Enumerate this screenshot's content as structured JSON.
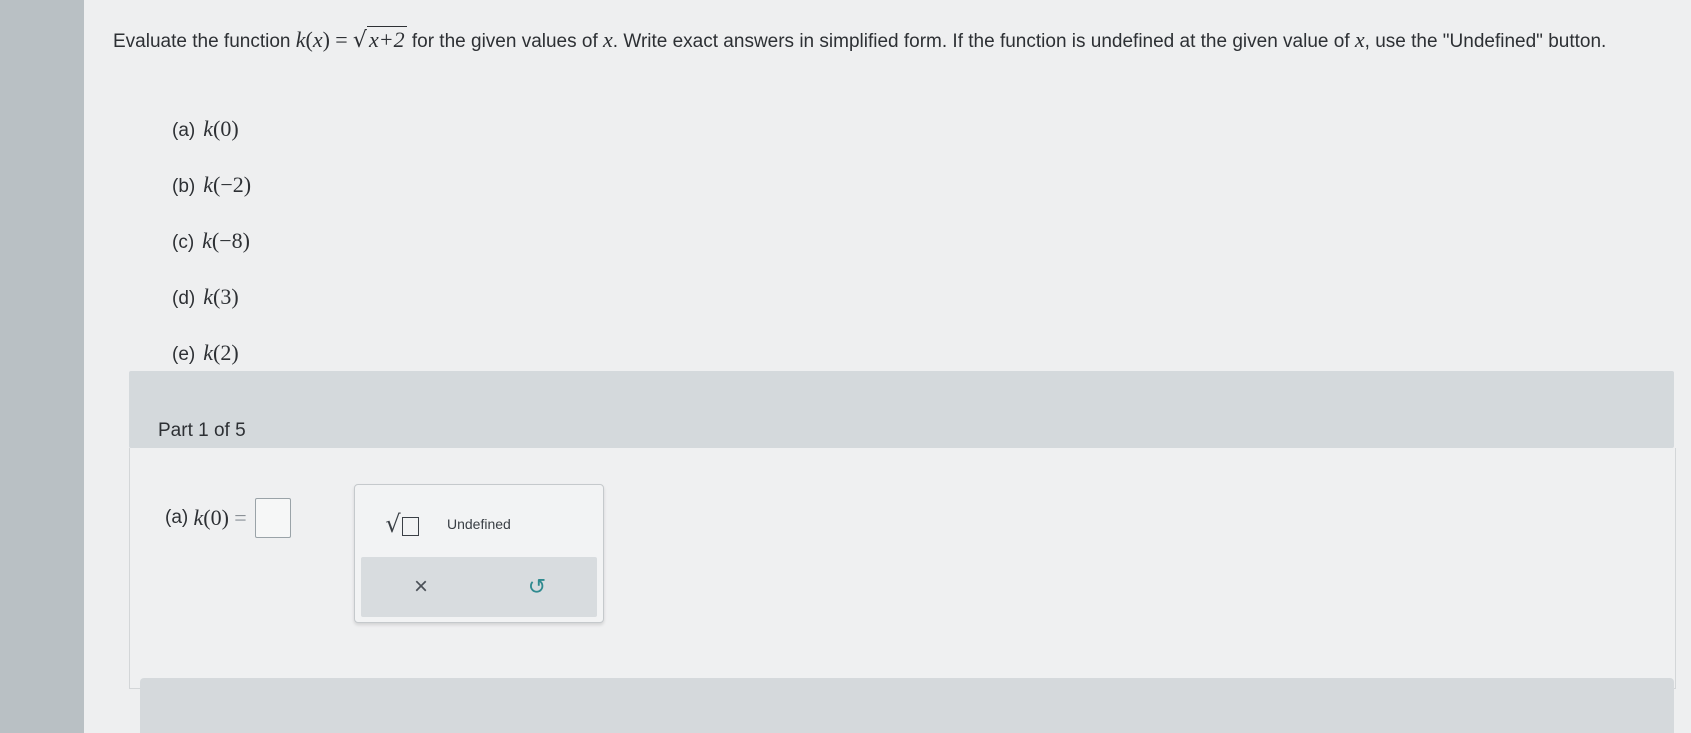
{
  "prompt": {
    "text_before": "Evaluate the function ",
    "func_name": "k",
    "func_arg": "x",
    "equals": "=",
    "radicand": "x+2",
    "text_mid": " for the given values of ",
    "var": "x",
    "text_mid2": ". Write exact answers in simplified form. If the function is undefined at the given value of ",
    "var2": "x",
    "text_end": ", use the \"Undefined\" button."
  },
  "items": [
    {
      "label": "(a)",
      "func": "k",
      "arg": "0"
    },
    {
      "label": "(b)",
      "func": "k",
      "arg": "−2"
    },
    {
      "label": "(c)",
      "func": "k",
      "arg": "−8"
    },
    {
      "label": "(d)",
      "func": "k",
      "arg": "3"
    },
    {
      "label": "(e)",
      "func": "k",
      "arg": "2"
    }
  ],
  "part": {
    "label": "Part 1 of 5"
  },
  "answer": {
    "label": "(a)",
    "func": "k",
    "arg": "0",
    "equals": "=",
    "value": ""
  },
  "keypad": {
    "sqrt_icon": "square-root-template-icon",
    "undefined_label": "Undefined",
    "clear_icon": "×",
    "undo_icon": "↺"
  }
}
